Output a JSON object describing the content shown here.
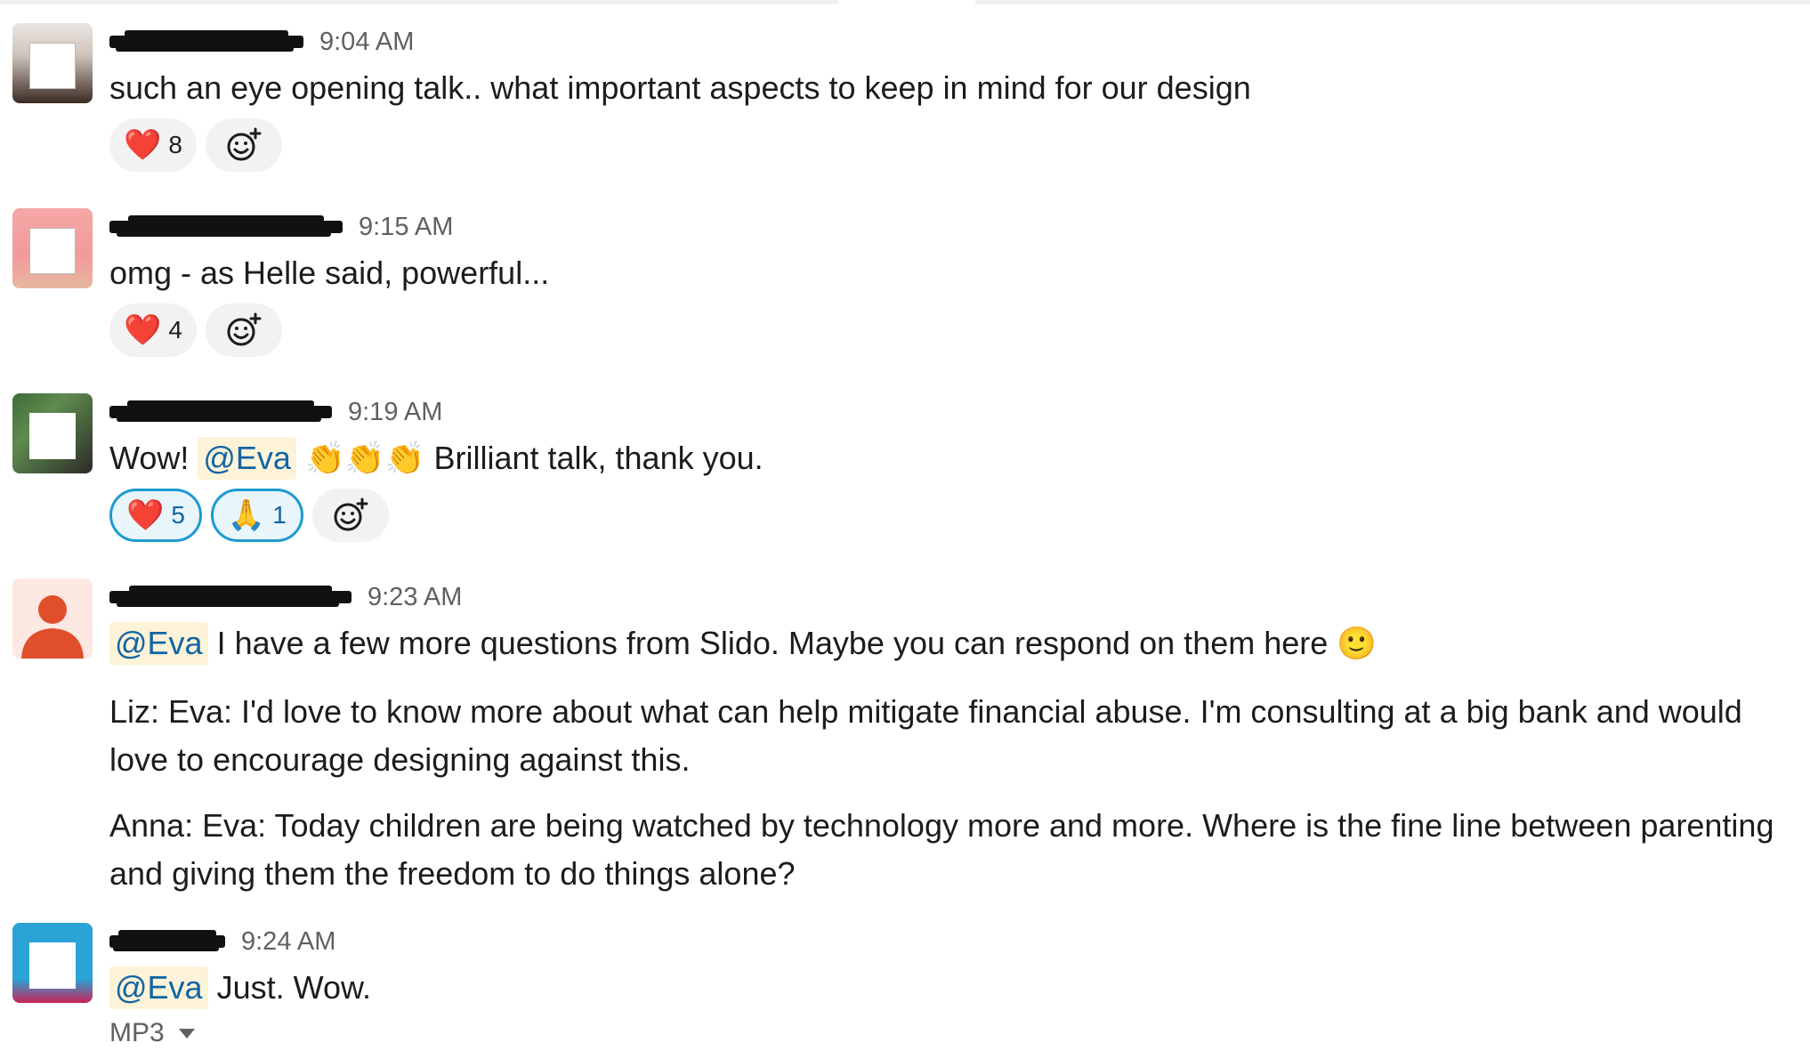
{
  "messages": [
    {
      "time": "9:04 AM",
      "text": "such an eye opening talk.. what important aspects to keep in mind for our design",
      "reactions": [
        {
          "emoji": "❤️",
          "count": "8"
        }
      ]
    },
    {
      "time": "9:15 AM",
      "text": "omg - as Helle said, powerful...",
      "reactions": [
        {
          "emoji": "❤️",
          "count": "4"
        }
      ]
    },
    {
      "time": "9:19 AM",
      "text_before": "Wow!",
      "mention": "@Eva",
      "emoji": "👏👏👏",
      "text_after": "Brilliant talk, thank you.",
      "reactions": [
        {
          "emoji": "❤️",
          "count": "5"
        },
        {
          "emoji": "🙏",
          "count": "1"
        }
      ]
    },
    {
      "time": "9:23 AM",
      "mention": "@Eva",
      "text": "I have a few more questions from Slido. Maybe you can respond on them here",
      "emoji": "🙂",
      "para1": "Liz: Eva: I'd love to know more about what can help mitigate financial abuse. I'm consulting at a big bank and would love to encourage designing against this.",
      "para2": "Anna: Eva: Today children are being watched by technology more and more. Where is the fine line between parenting and giving them the freedom to do things alone?"
    },
    {
      "time": "9:24 AM",
      "mention": "@Eva",
      "text": "Just. Wow.",
      "attachment": "MP3"
    }
  ],
  "icons": {
    "add_reaction": "add-reaction-icon"
  },
  "colors": {
    "mention_text": "#1264a3",
    "mention_bg": "#fdf3d8",
    "active_reaction_border": "#1d9bd1"
  }
}
